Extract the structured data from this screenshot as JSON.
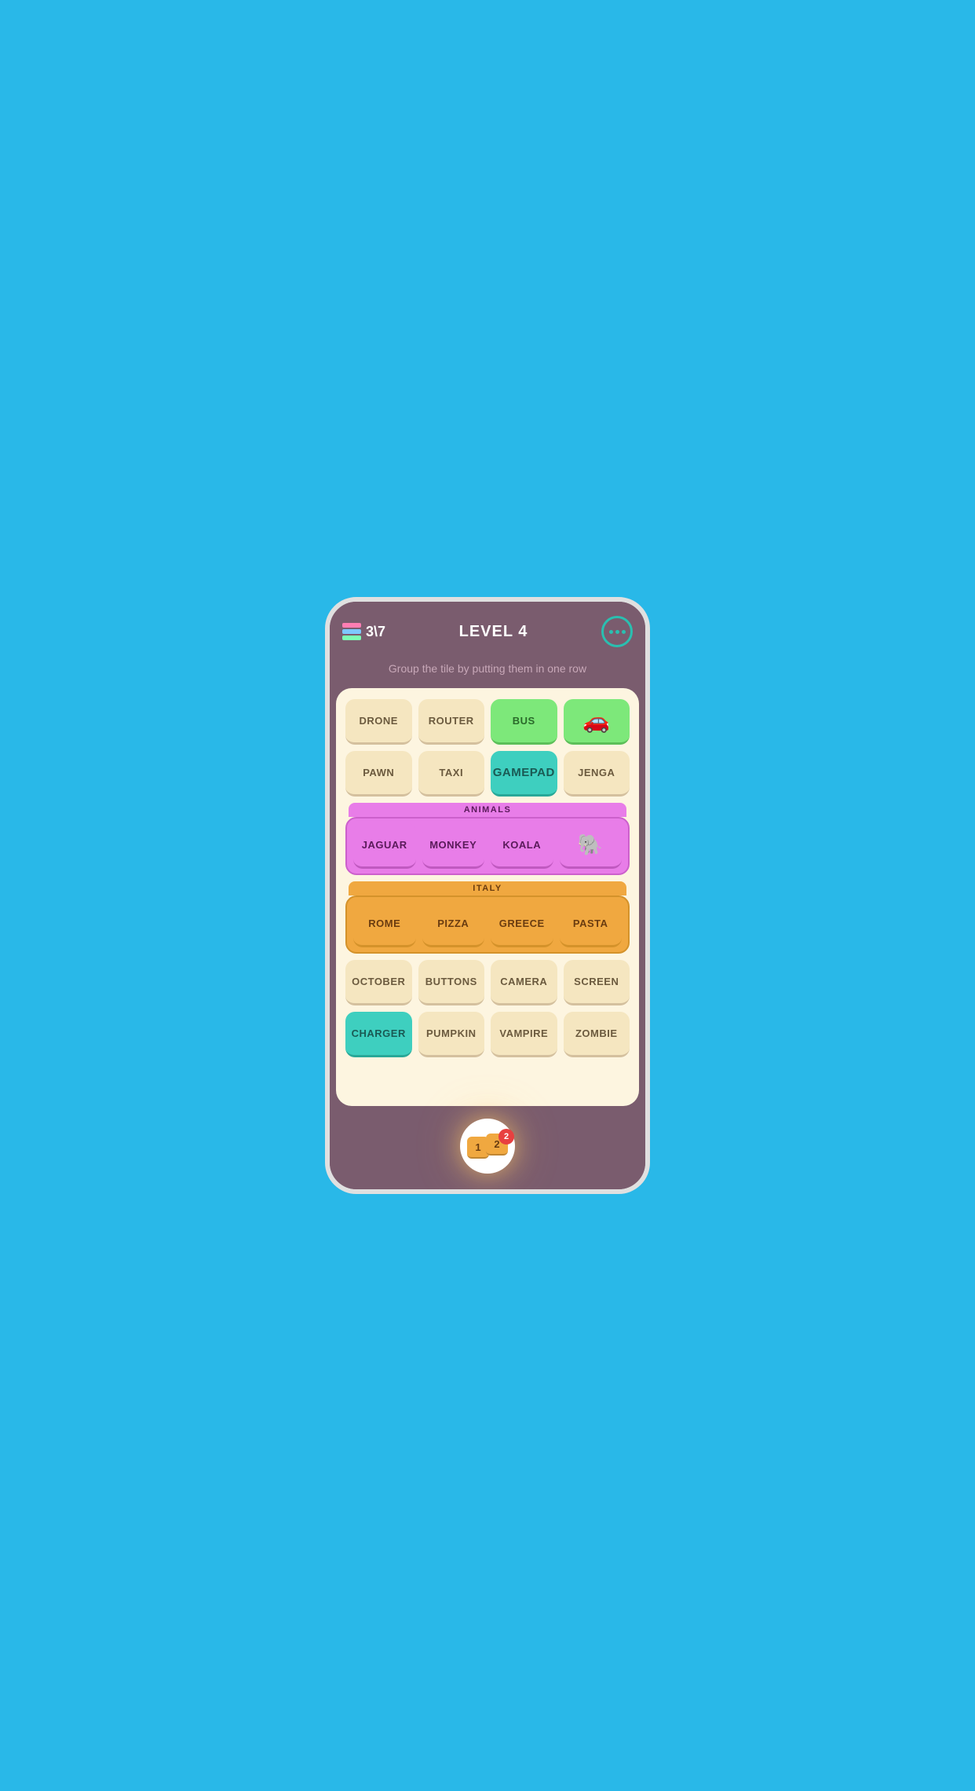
{
  "header": {
    "score": "3\\7",
    "level": "LEVEL 4",
    "menu_label": "menu"
  },
  "subtitle": "Group the tile by putting them\nin one row",
  "rows": [
    {
      "id": "row1",
      "tiles": [
        {
          "id": "drone",
          "label": "DRONE",
          "style": "cream"
        },
        {
          "id": "router",
          "label": "ROUTER",
          "style": "cream"
        },
        {
          "id": "bus",
          "label": "BUS",
          "style": "green"
        },
        {
          "id": "car-icon",
          "label": "🚗",
          "style": "green",
          "is_icon": true
        }
      ]
    },
    {
      "id": "row2",
      "tiles": [
        {
          "id": "pawn",
          "label": "PAWN",
          "style": "cream"
        },
        {
          "id": "taxi",
          "label": "TAXI",
          "style": "cream"
        },
        {
          "id": "gamepad",
          "label": "GAMEPAD",
          "style": "teal"
        },
        {
          "id": "jenga",
          "label": "JENGA",
          "style": "cream"
        }
      ]
    }
  ],
  "groups": [
    {
      "id": "animals",
      "label": "ANIMALS",
      "color": "pink",
      "tiles": [
        {
          "id": "jaguar",
          "label": "JAGUAR"
        },
        {
          "id": "monkey",
          "label": "MONKEY"
        },
        {
          "id": "koala",
          "label": "KOALA"
        },
        {
          "id": "elephant",
          "label": "🐘",
          "is_icon": true
        }
      ]
    },
    {
      "id": "italy",
      "label": "ITALY",
      "color": "orange",
      "tiles": [
        {
          "id": "rome",
          "label": "ROME"
        },
        {
          "id": "pizza",
          "label": "PIZZA"
        },
        {
          "id": "greece",
          "label": "GREECE"
        },
        {
          "id": "pasta",
          "label": "PASTA"
        }
      ]
    }
  ],
  "bottom_rows": [
    {
      "id": "row5",
      "tiles": [
        {
          "id": "october",
          "label": "OCTOBER",
          "style": "cream"
        },
        {
          "id": "buttons",
          "label": "BUTTONS",
          "style": "cream"
        },
        {
          "id": "camera",
          "label": "CAMERA",
          "style": "cream"
        },
        {
          "id": "screen",
          "label": "SCREEN",
          "style": "cream"
        }
      ]
    },
    {
      "id": "row6",
      "tiles": [
        {
          "id": "charger",
          "label": "CHARGER",
          "style": "teal"
        },
        {
          "id": "pumpkin",
          "label": "PUMPKIN",
          "style": "cream"
        },
        {
          "id": "vampire",
          "label": "VAMPIRE",
          "style": "cream"
        },
        {
          "id": "zombie",
          "label": "ZOMBIE",
          "style": "cream"
        }
      ]
    }
  ],
  "hint": {
    "count": "2",
    "tile1_label": "1",
    "tile2_label": "2"
  }
}
